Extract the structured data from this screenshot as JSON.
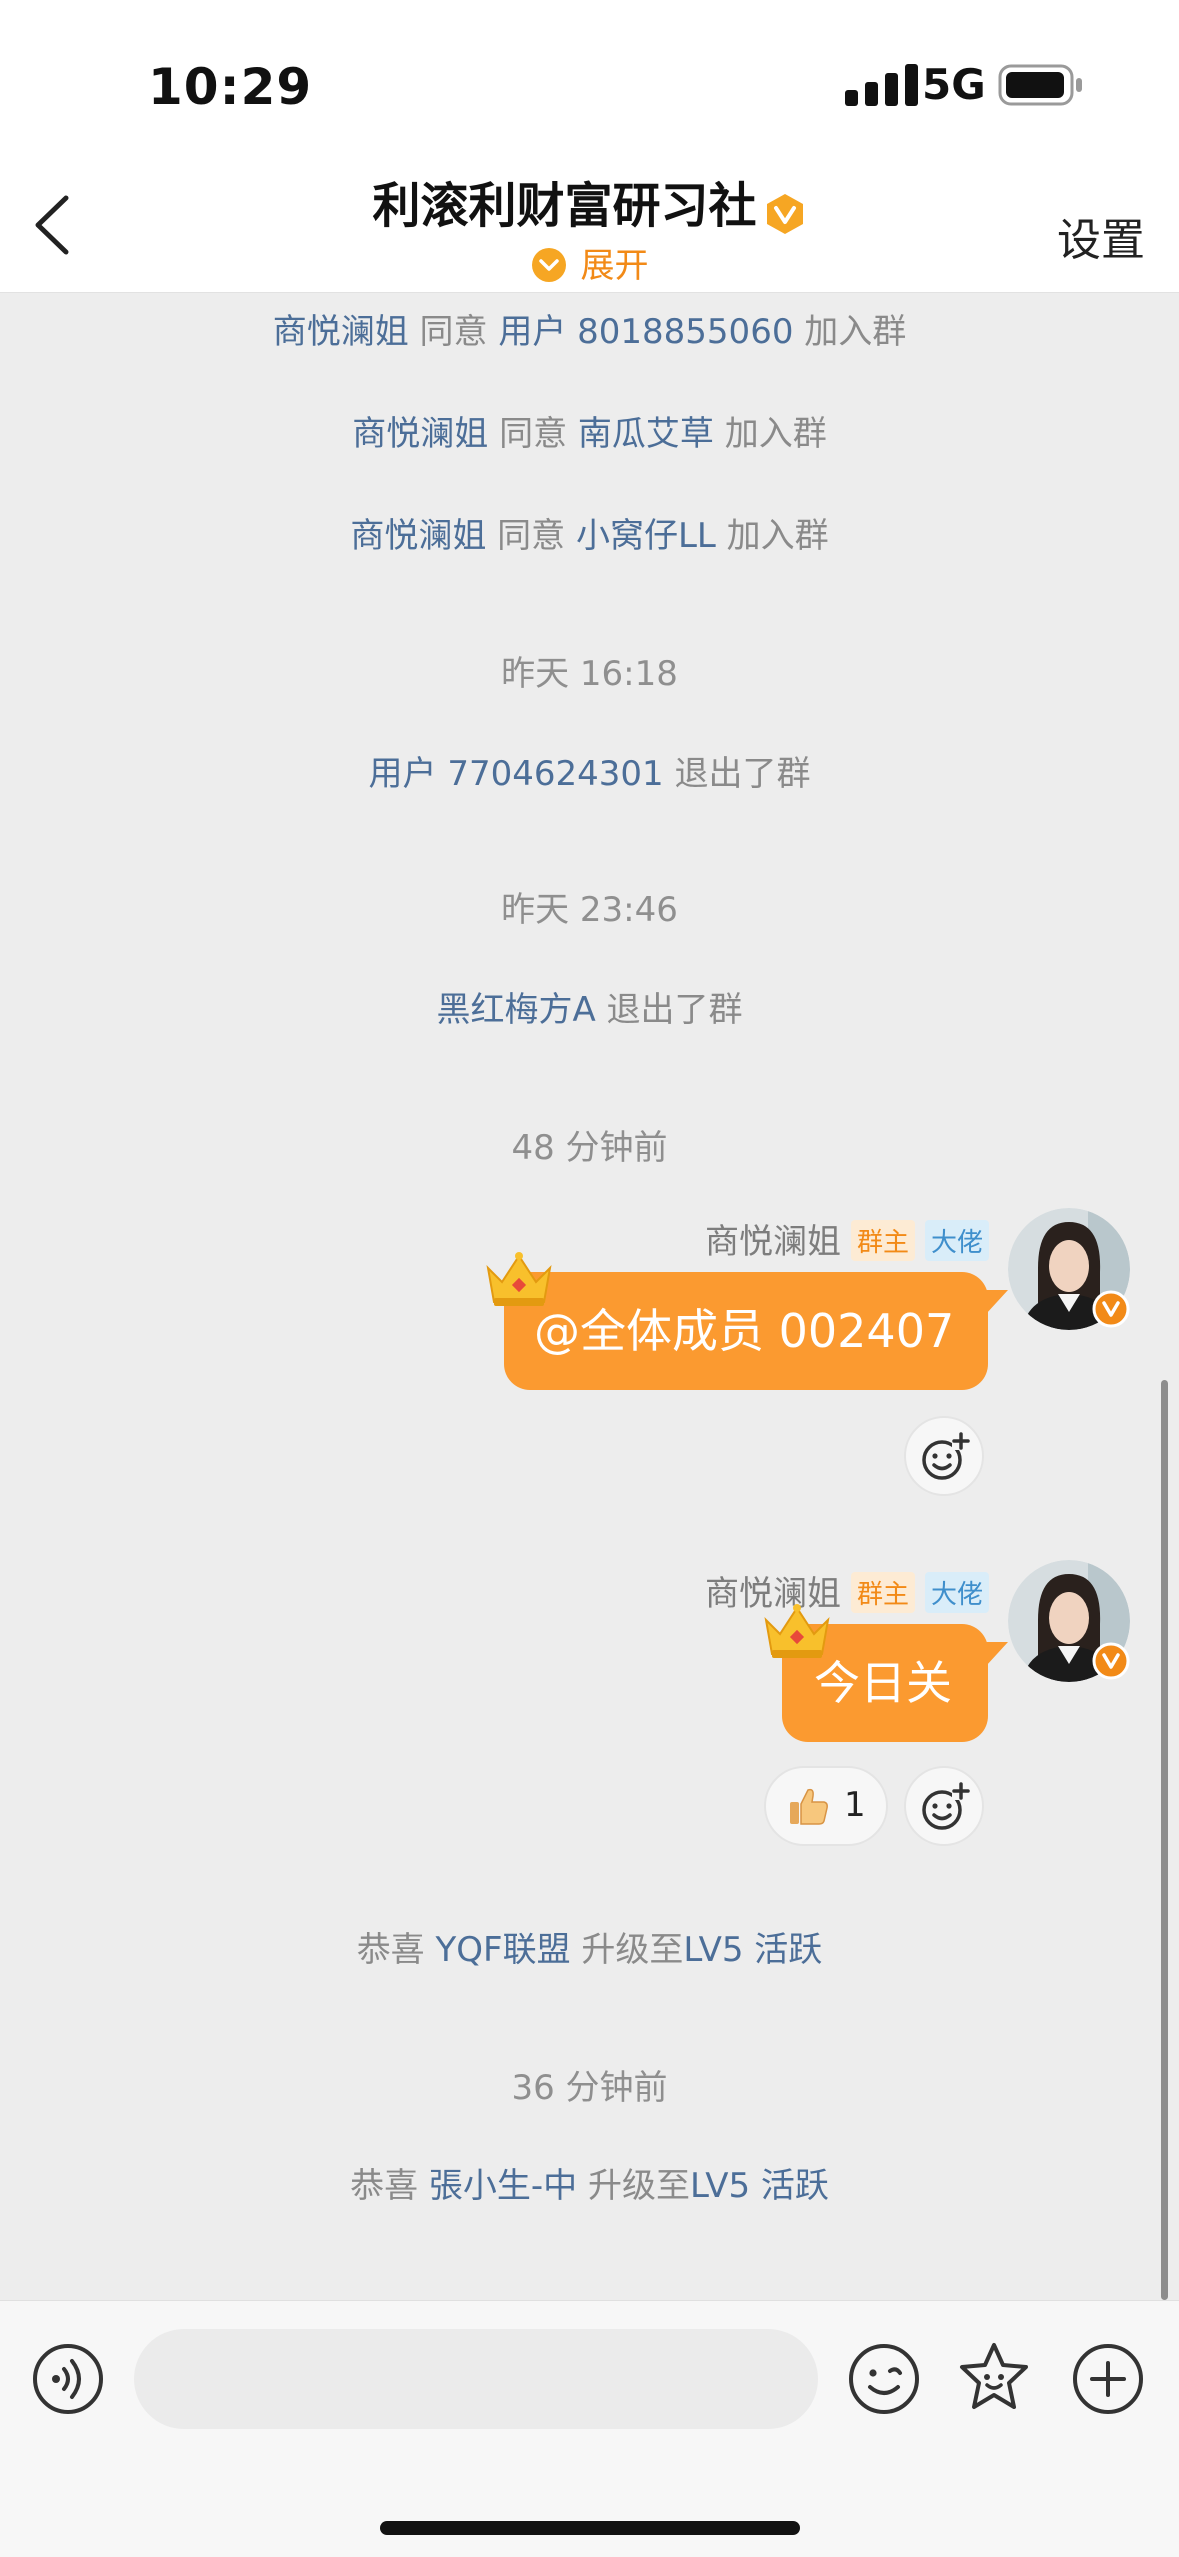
{
  "status_bar": {
    "time": "10:29",
    "network": "5G"
  },
  "header": {
    "title": "利滚利财富研习社",
    "expand_label": "展开",
    "settings_label": "设置"
  },
  "system_messages": [
    {
      "actor": "商悦澜姐",
      "verb": "同意",
      "target": "用户 8018855060",
      "suffix": "加入群"
    },
    {
      "actor": "商悦澜姐",
      "verb": "同意",
      "target": "南瓜艾草",
      "suffix": "加入群"
    },
    {
      "actor": "商悦澜姐",
      "verb": "同意",
      "target": "小窝仔LL",
      "suffix": "加入群"
    },
    {
      "actor": "用户 7704624301",
      "suffix": "退出了群"
    },
    {
      "actor": "黑红梅方A",
      "suffix": "退出了群"
    },
    {
      "prefix": "恭喜",
      "actor": "YQF联盟",
      "verb": "升级至",
      "target": "LV5 活跃"
    },
    {
      "prefix": "恭喜",
      "actor": "張小生-中",
      "verb": "升级至",
      "target": "LV5 活跃"
    }
  ],
  "timestamps": [
    "昨天 16:18",
    "昨天 23:46",
    "48 分钟前",
    "36 分钟前"
  ],
  "messages": [
    {
      "sender": "商悦澜姐",
      "role_tag": "群主",
      "level_tag": "大佬",
      "text": "@全体成员 002407"
    },
    {
      "sender": "商悦澜姐",
      "role_tag": "群主",
      "level_tag": "大佬",
      "text": "今日关",
      "reactions": [
        {
          "emoji_icon": "thumbs-up-icon",
          "count": "1"
        }
      ]
    }
  ],
  "input": {
    "placeholder": ""
  },
  "colors": {
    "accent": "#fb9a30",
    "link": "#4c6e98",
    "owner_tag": "#f28a17",
    "big_tag": "#3f8fcc"
  }
}
